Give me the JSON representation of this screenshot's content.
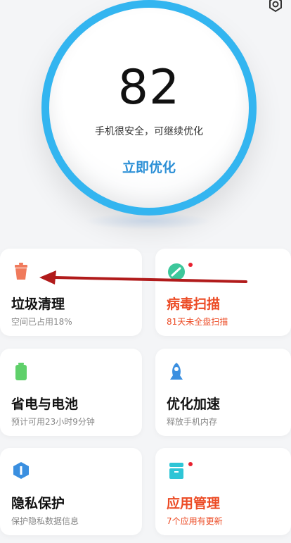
{
  "score": {
    "value": "82",
    "status_text": "手机很安全，可继续优化",
    "action_label": "立即优化",
    "ring_color": "#33b5f0",
    "action_color": "#2b8fd6"
  },
  "cards": [
    {
      "title": "垃圾清理",
      "subtitle": "空间已占用18%",
      "icon": "trash-icon",
      "icon_color": "#f07a5c",
      "alert": false,
      "badge": false
    },
    {
      "title": "病毒扫描",
      "subtitle": "81天未全盘扫描",
      "icon": "shield-scan-icon",
      "icon_color": "#3dc79b",
      "alert": true,
      "badge": true
    },
    {
      "title": "省电与电池",
      "subtitle": "预计可用23小时9分钟",
      "icon": "battery-icon",
      "icon_color": "#5fd06a",
      "alert": false,
      "badge": false
    },
    {
      "title": "优化加速",
      "subtitle": "释放手机内存",
      "icon": "rocket-icon",
      "icon_color": "#3a8fe0",
      "alert": false,
      "badge": false
    },
    {
      "title": "隐私保护",
      "subtitle": "保护隐私数据信息",
      "icon": "privacy-icon",
      "icon_color": "#3a8fe0",
      "alert": false,
      "badge": false
    },
    {
      "title": "应用管理",
      "subtitle": "7个应用有更新",
      "icon": "app-manage-icon",
      "icon_color": "#2ec5d6",
      "alert": true,
      "badge": true
    }
  ],
  "colors": {
    "alert_text": "#ec4b25",
    "badge": "#e8202f",
    "annotation_arrow": "#b11b1b"
  }
}
